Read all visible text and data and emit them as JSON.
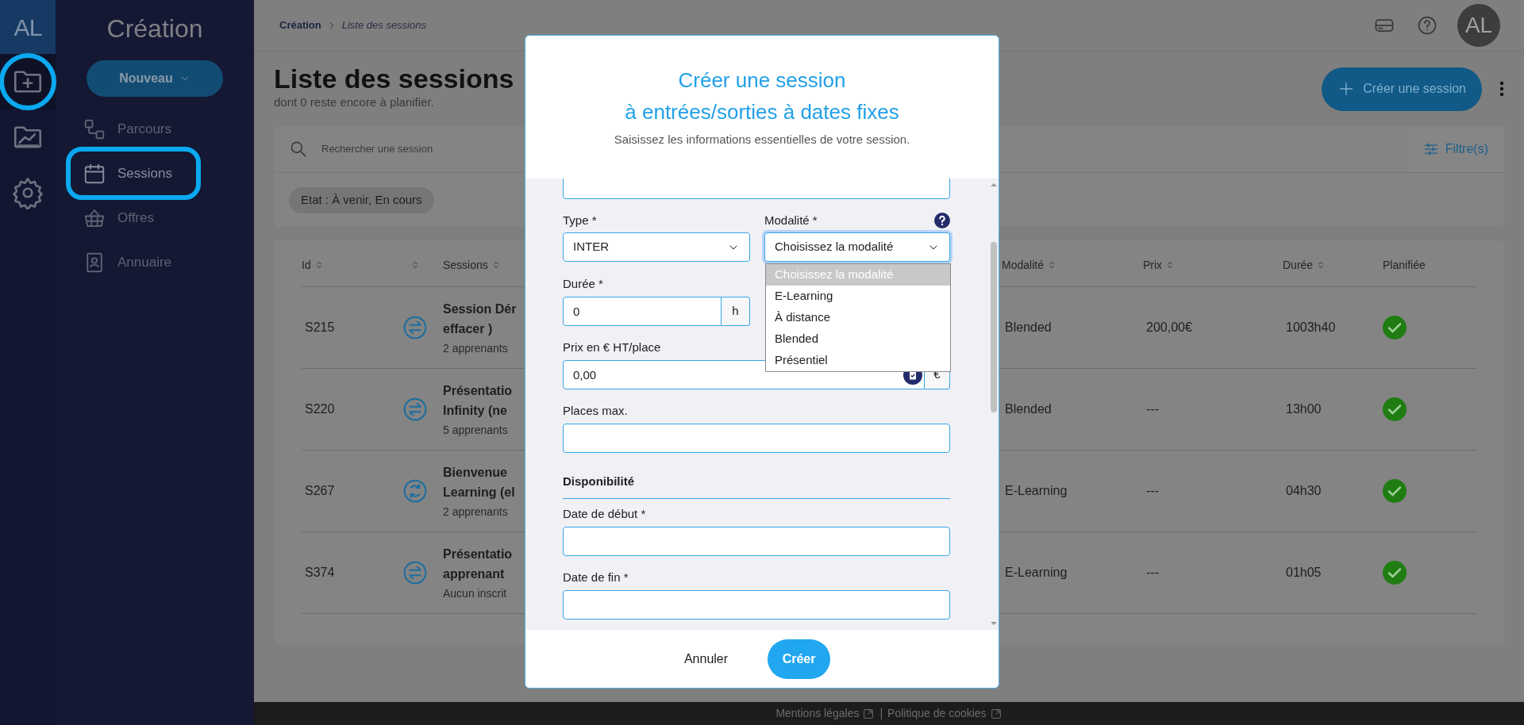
{
  "rail": {
    "logo": "AL",
    "items": [
      {
        "kind": "folder-plus",
        "selected": true
      },
      {
        "kind": "chart",
        "selected": false
      },
      {
        "kind": "gear",
        "selected": false
      }
    ]
  },
  "sidebar": {
    "title": "Création",
    "new_button": "Nouveau",
    "items": [
      {
        "kind": "flow",
        "label": "Parcours",
        "selected": false
      },
      {
        "kind": "calendar",
        "label": "Sessions",
        "selected": true
      },
      {
        "kind": "basket",
        "label": "Offres",
        "selected": false
      },
      {
        "kind": "contact",
        "label": "Annuaire",
        "selected": false
      }
    ]
  },
  "header": {
    "breadcrumb": [
      "Création",
      "Liste des sessions"
    ],
    "avatar": "AL"
  },
  "page": {
    "title": "Liste des sessions",
    "subtitle": "dont 0 reste encore à planifier.",
    "create_button": "Créer une session"
  },
  "search": {
    "placeholder": "Rechercher une session",
    "filter_button": "Filtre(s)",
    "chips": [
      "Etat : À venir, En cours"
    ]
  },
  "table": {
    "columns": [
      {
        "label": "Id",
        "sortable": true
      },
      {
        "sortable": true
      },
      {
        "label": "Sessions",
        "sortable": true
      },
      {
        "label": "Modalité",
        "sortable": true
      },
      {
        "label": "Prix",
        "sortable": true
      },
      {
        "label": "Durée",
        "sortable": true
      },
      {
        "label": "Planifiée",
        "sortable": false
      }
    ],
    "rows": [
      {
        "id": "S215",
        "kind": "swap",
        "title_lines": [
          "Session Dér",
          "effacer )"
        ],
        "learners": "2 apprenants",
        "modality": "Blended",
        "price": "200,00€",
        "duration": "1003h40",
        "planned": true
      },
      {
        "id": "S220",
        "kind": "swap",
        "title_lines": [
          "Présentatio",
          "Infinity (ne"
        ],
        "learners": "5 apprenants",
        "modality": "Blended",
        "price": "---",
        "duration": "13h00",
        "planned": true
      },
      {
        "id": "S267",
        "kind": "cycle",
        "title_lines": [
          "Bienvenue",
          "Learning (el"
        ],
        "learners": "2 apprenants",
        "modality": "E-Learning",
        "price": "---",
        "duration": "04h30",
        "planned": true
      },
      {
        "id": "S374",
        "kind": "swap",
        "title_lines": [
          "Présentatio",
          "apprenant"
        ],
        "learners": "Aucun inscrit",
        "modality": "E-Learning",
        "price": "---",
        "duration": "01h05",
        "planned": true
      }
    ]
  },
  "modal": {
    "title_lines": [
      "Créer une session",
      "à entrées/sorties à dates fixes"
    ],
    "subtitle": "Saisissez les informations essentielles de votre session.",
    "form": {
      "type": {
        "label": "Type *",
        "value": "INTER"
      },
      "modality": {
        "label": "Modalité *",
        "value": "Choisissez la modalité",
        "options": [
          {
            "label": "Choisissez la modalité",
            "selected": true
          },
          {
            "label": "E-Learning",
            "selected": false
          },
          {
            "label": "À distance",
            "selected": false
          },
          {
            "label": "Blended",
            "selected": false
          },
          {
            "label": "Présentiel",
            "selected": false
          }
        ]
      },
      "duration": {
        "label": "Durée *",
        "value": "0",
        "unit": "h"
      },
      "price": {
        "label": "Prix en € HT/place",
        "value": "0,00",
        "unit": "€"
      },
      "seats": {
        "label": "Places max."
      },
      "section": "Disponibilité",
      "start": {
        "label": "Date de début *"
      },
      "end": {
        "label": "Date de fin *"
      }
    },
    "cancel_button": "Annuler",
    "submit_button": "Créer"
  },
  "footer": {
    "links": [
      "Mentions légales",
      "Politique de cookies"
    ],
    "separator": "|"
  }
}
